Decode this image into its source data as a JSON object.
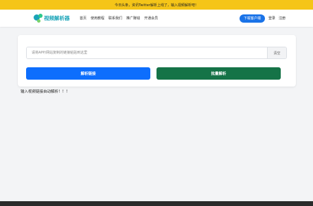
{
  "announcement": "今日头条，资讯Twitter解析上线了，输入视频解析吧！",
  "header": {
    "logo_text": "视频解析器",
    "nav": [
      "首页",
      "使用教程",
      "联系我们",
      "推广赚钱",
      "开通会员"
    ],
    "download_label": "下载客户端",
    "login_label": "登录",
    "register_label": "注册"
  },
  "main": {
    "input_placeholder": "请将APP/网站复制的链接粘贴到这里",
    "input_value": "",
    "clear_label": "清空",
    "parse_label": "解析链接",
    "batch_label": "批量解析",
    "hint": "输入视频链接自动解析！！！"
  },
  "colors": {
    "announcement_bg": "#f5c518",
    "primary": "#0d6efd",
    "success": "#157347",
    "logo": "#1aa4b8"
  }
}
